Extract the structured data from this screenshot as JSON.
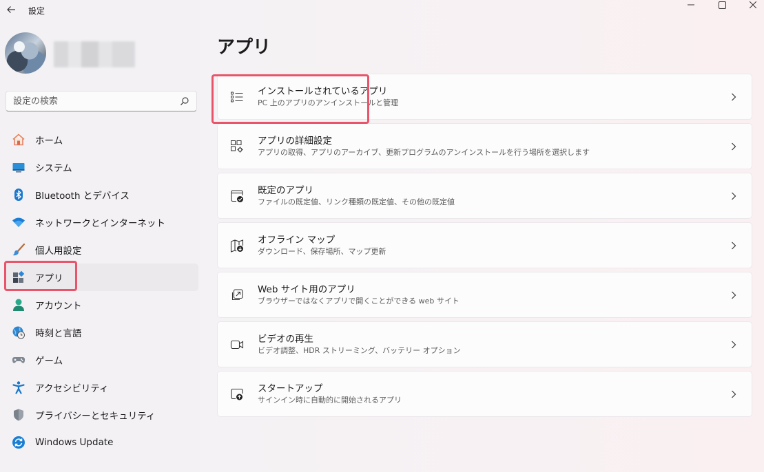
{
  "window": {
    "title": "設定"
  },
  "sidebar": {
    "search": {
      "placeholder": "設定の検索"
    },
    "items": [
      {
        "label": "ホーム"
      },
      {
        "label": "システム"
      },
      {
        "label": "Bluetooth とデバイス"
      },
      {
        "label": "ネットワークとインターネット"
      },
      {
        "label": "個人用設定"
      },
      {
        "label": "アプリ",
        "selected": true
      },
      {
        "label": "アカウント"
      },
      {
        "label": "時刻と言語"
      },
      {
        "label": "ゲーム"
      },
      {
        "label": "アクセシビリティ"
      },
      {
        "label": "プライバシーとセキュリティ"
      },
      {
        "label": "Windows Update"
      }
    ]
  },
  "main": {
    "title": "アプリ",
    "cards": [
      {
        "title": "インストールされているアプリ",
        "subtitle": "PC 上のアプリのアンインストールと管理",
        "icon": "list-icon"
      },
      {
        "title": "アプリの詳細設定",
        "subtitle": "アプリの取得、アプリのアーカイブ、更新プログラムのアンインストールを行う場所を選択します",
        "icon": "app-gear-icon"
      },
      {
        "title": "既定のアプリ",
        "subtitle": "ファイルの既定値、リンク種類の既定値、その他の既定値",
        "icon": "default-app-icon"
      },
      {
        "title": "オフライン マップ",
        "subtitle": "ダウンロード、保存場所、マップ更新",
        "icon": "map-download-icon"
      },
      {
        "title": "Web サイト用のアプリ",
        "subtitle": "ブラウザーではなくアプリで開くことができる web サイト",
        "icon": "open-external-icon"
      },
      {
        "title": "ビデオの再生",
        "subtitle": "ビデオ調整、HDR ストリーミング、バッテリー オプション",
        "icon": "video-icon"
      },
      {
        "title": "スタートアップ",
        "subtitle": "サインイン時に自動的に開始されるアプリ",
        "icon": "startup-icon"
      }
    ]
  },
  "colors": {
    "highlight": "#e8546a",
    "accent": "#0067c0"
  }
}
